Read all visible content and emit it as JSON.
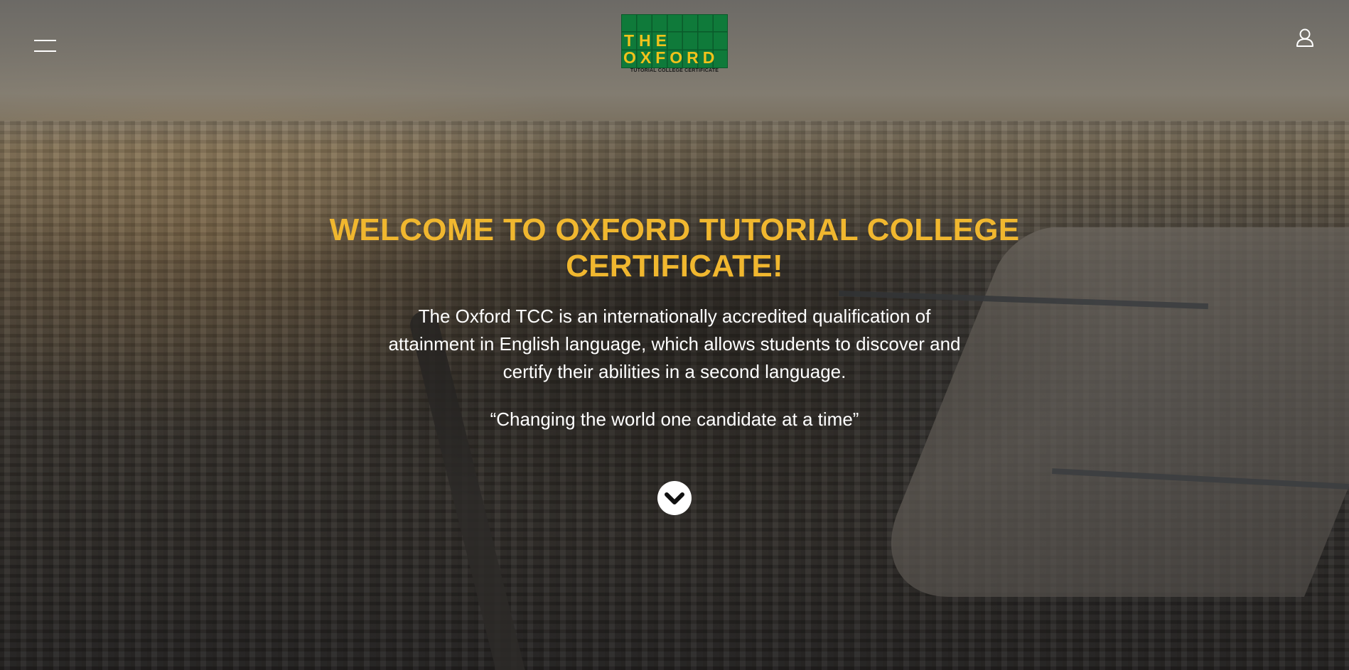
{
  "header": {
    "menu_icon": "hamburger-menu-icon",
    "user_icon": "user-account-icon",
    "logo": {
      "line1": "THE",
      "line2": "OXFORD",
      "caption": "TUTORIAL COLLEGE CERTIFICATE",
      "colors": {
        "background": "#0f7a3a",
        "letters": "#f1c21b"
      }
    }
  },
  "hero": {
    "title": "WELCOME TO OXFORD TUTORIAL COLLEGE CERTIFICATE!",
    "description": "The Oxford TCC is an internationally accredited qualification of attainment in English language, which allows students to discover and certify their abilities in a second language.",
    "quote": "“Changing the world one candidate at a time”",
    "scroll_icon": "chevron-down-circle-icon"
  },
  "colors": {
    "accent": "#f0b72f",
    "text": "#ffffff"
  }
}
